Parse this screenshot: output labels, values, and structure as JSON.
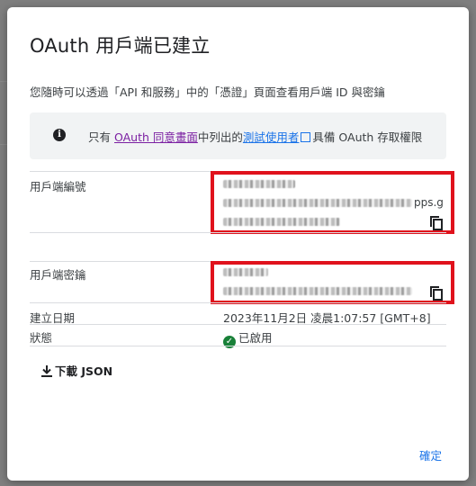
{
  "dialog": {
    "title": "OAuth 用戶端已建立",
    "subtitle": "您隨時可以透過「API 和服務」中的「憑證」頁面查看用戶端 ID 與密鑰",
    "notice": {
      "prefix": "只有",
      "consent_link": "OAuth 同意畫面",
      "middle": "中列出的",
      "test_users_link": "測試使用者",
      "suffix": "具備 OAuth 存取權限"
    },
    "client_id": {
      "label": "用戶端編號",
      "visible_fragment": "pps.g"
    },
    "client_secret": {
      "label": "用戶端密鑰"
    },
    "creation_date": {
      "label": "建立日期",
      "value": "2023年11月2日 凌晨1:07:57 [GMT+8]"
    },
    "status": {
      "label": "狀態",
      "value": "已啟用"
    },
    "download_label": "下載 JSON",
    "confirm_label": "確定"
  },
  "icons": [
    "info-icon",
    "external-link-icon",
    "copy-icon",
    "check-circle-icon",
    "download-icon"
  ],
  "colors": {
    "link": "#1a73e8",
    "visited_link": "#7b1fa2",
    "status_green": "#188038",
    "highlight_red": "#e0121c"
  }
}
